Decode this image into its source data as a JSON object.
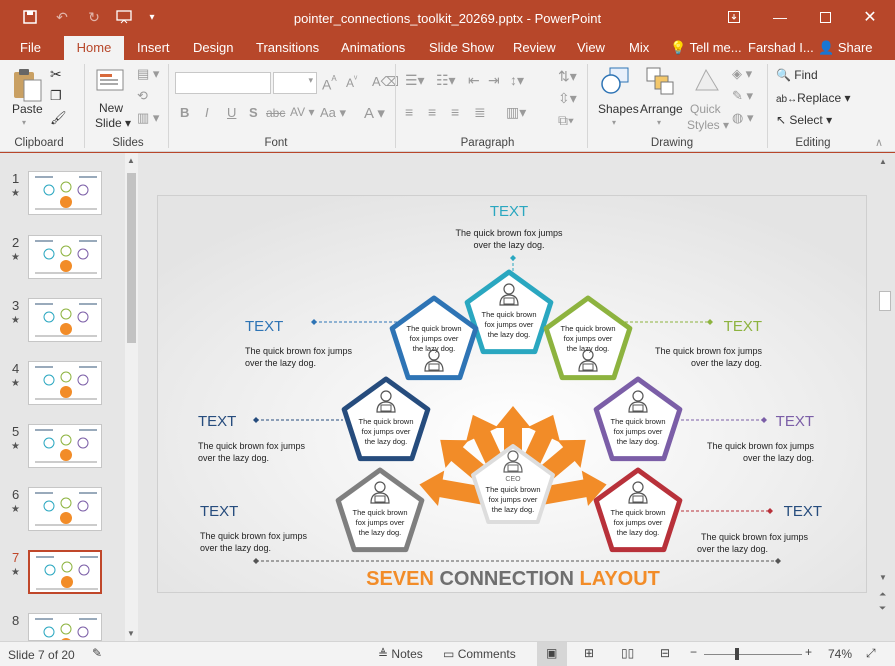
{
  "app": {
    "doc_title": "pointer_connections_toolkit_20269.pptx - PowerPoint",
    "save_icon": "save-icon",
    "undo_icon": "undo-icon",
    "redo_icon": "redo-icon"
  },
  "tabs": {
    "file": "File",
    "home": "Home",
    "insert": "Insert",
    "design": "Design",
    "transitions": "Transitions",
    "animations": "Animations",
    "slideshow": "Slide Show",
    "review": "Review",
    "view": "View",
    "mix": "Mix",
    "tellme": "Tell me...",
    "user": "Farshad I...",
    "share": "Share"
  },
  "ribbon": {
    "paste": "Paste",
    "new_slide_1": "New",
    "new_slide_2": "Slide",
    "shapes": "Shapes",
    "arrange": "Arrange",
    "quick_styles_1": "Quick",
    "quick_styles_2": "Styles",
    "find": "Find",
    "replace": "Replace",
    "select": "Select",
    "bold": "B",
    "italic": "I",
    "underline": "U",
    "strike": "S",
    "abc": "abc",
    "av": "AV",
    "aa": "Aa",
    "a": "A",
    "groups": {
      "clipboard": "Clipboard",
      "slides": "Slides",
      "font": "Font",
      "paragraph": "Paragraph",
      "drawing": "Drawing",
      "editing": "Editing"
    }
  },
  "thumbnails": [
    {
      "num": "1",
      "star": "★"
    },
    {
      "num": "2",
      "star": "★"
    },
    {
      "num": "3",
      "star": "★"
    },
    {
      "num": "4",
      "star": "★"
    },
    {
      "num": "5",
      "star": "★"
    },
    {
      "num": "6",
      "star": "★"
    },
    {
      "num": "7",
      "star": "★"
    },
    {
      "num": "8",
      "star": ""
    }
  ],
  "slide": {
    "top_title": "TEXT",
    "top_desc_1": "The quick brown fox jumps",
    "top_desc_2": "over the lazy dog.",
    "heading_seven": "SEVEN",
    "heading_connection": "CONNECTION",
    "heading_layout": "LAYOUT",
    "node_text_1": "The quick brown",
    "node_text_2": "fox jumps over",
    "node_text_3": "the lazy dog.",
    "ceo_label": "CEO",
    "ceo_text_1": "The quick brown",
    "ceo_text_2": "fox jumps over",
    "ceo_text_3": "the lazy dog.",
    "left_title_1": "TEXT",
    "left_title_2": "TEXT",
    "left_title_3": "TEXT",
    "right_title_1": "TEXT",
    "right_title_2": "TEXT",
    "right_title_3": "TEXT",
    "side_desc_1": "The quick brown fox jumps",
    "side_desc_2": "over the lazy dog."
  },
  "colors": {
    "teal": "#2aa7c0",
    "green": "#8db33f",
    "purple": "#7b5ea7",
    "red": "#b8313a",
    "gray": "#7f7f7f",
    "navy": "#264c7d",
    "blue": "#2e74b5",
    "orange": "#f28c28"
  },
  "status": {
    "slide_counter": "Slide 7 of 20",
    "notes": "Notes",
    "comments": "Comments",
    "zoom": "74%",
    "minus": "−",
    "plus": "+"
  }
}
